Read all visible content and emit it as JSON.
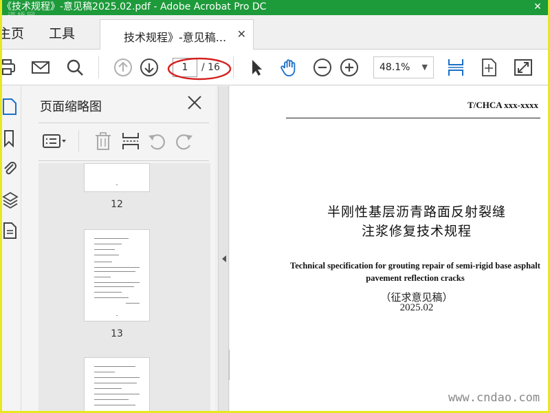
{
  "window": {
    "title": "《技术规程》-意见稿2025.02.pdf - Adobe Acrobat Pro DC",
    "watermark": "道桥网",
    "close_glyph": "✕"
  },
  "tabs": {
    "home": "主页",
    "tools": "工具",
    "document": "技术规程》-意见稿...",
    "close_glyph": "✕"
  },
  "toolbar": {
    "page_current": "1",
    "page_total": "/ 16",
    "zoom": "48.1%",
    "zoom_caret": "▼",
    "icons": [
      "print-icon",
      "mail-icon",
      "search-icon",
      "page-up-icon",
      "page-down-icon",
      "select-arrow-icon",
      "hand-icon",
      "zoom-out-icon",
      "zoom-in-icon",
      "fit-width-icon",
      "page-fit-icon",
      "fullscreen-icon"
    ]
  },
  "thumbnails": {
    "title": "页面缩略图",
    "pages": [
      {
        "number": "12"
      },
      {
        "number": "13"
      }
    ]
  },
  "document": {
    "code": "T/CHCA xxx-xxxx",
    "title_cn_line1": "半刚性基层沥青路面反射裂缝",
    "title_cn_line2": "注浆修复技术规程",
    "title_en_line1": "Technical specification for grouting repair of semi-rigid base asphalt",
    "title_en_line2": "pavement reflection cracks",
    "draft_note": "（征求意见稿）",
    "date": "2025.02"
  },
  "site_mark": "www.cndao.com",
  "colors": {
    "titlebar": "#1d9a3a",
    "accent_blue": "#1a6fc9",
    "annotation_red": "#d62020",
    "border_yellow": "#e8e81e"
  }
}
